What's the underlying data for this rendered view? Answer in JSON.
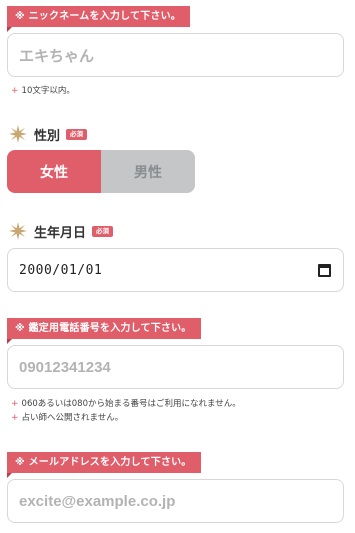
{
  "nickname": {
    "tag_label": "※ ニックネームを入力して下さい。",
    "placeholder": "エキちゃん",
    "note": "10文字以内。"
  },
  "gender": {
    "title": "性別",
    "required_badge": "必須",
    "options": [
      "女性",
      "男性"
    ],
    "selected": "女性"
  },
  "birthdate": {
    "title": "生年月日",
    "required_badge": "必須",
    "value": "2000/01/01"
  },
  "phone": {
    "tag_label": "※ 鑑定用電話番号を入力して下さい。",
    "placeholder": "09012341234",
    "notes": [
      "060あるいは080から始まる番号はご利用になれません。",
      "占い師へ公開されません。"
    ]
  },
  "email": {
    "tag_label": "※ メールアドレスを入力して下さい。",
    "placeholder": "excite@example.co.jp"
  },
  "colors": {
    "accent": "#e05d6a",
    "inactive": "#c4c6c8",
    "star": "#c9a772"
  },
  "icons": {
    "section_marker": "sparkle-star-icon",
    "date_picker": "calendar-icon",
    "note_bullet": "plus-icon"
  }
}
